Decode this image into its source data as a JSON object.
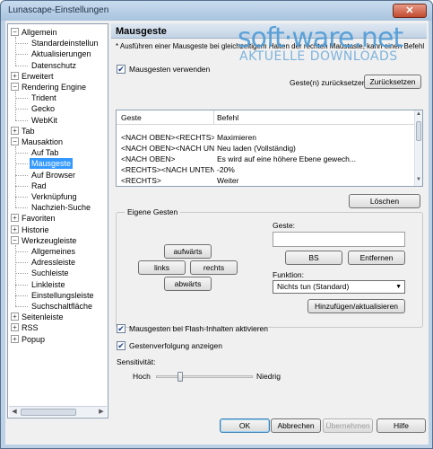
{
  "window": {
    "title": "Lunascape-Einstellungen",
    "close_glyph": "✕"
  },
  "watermark": {
    "main": "soft·ware.net",
    "sub": "AKTUELLE DOWNLOADS"
  },
  "tree": {
    "items": [
      {
        "label": "Allgemein",
        "expander": "−",
        "level": 0
      },
      {
        "label": "Standardeinstellun",
        "level": 1
      },
      {
        "label": "Aktualisierungen",
        "level": 1
      },
      {
        "label": "Datenschutz",
        "level": 1
      },
      {
        "label": "Erweitert",
        "expander": "+",
        "level": 0
      },
      {
        "label": "Rendering Engine",
        "expander": "−",
        "level": 0
      },
      {
        "label": "Trident",
        "level": 1
      },
      {
        "label": "Gecko",
        "level": 1
      },
      {
        "label": "WebKit",
        "level": 1
      },
      {
        "label": "Tab",
        "expander": "+",
        "level": 0
      },
      {
        "label": "Mausaktion",
        "expander": "−",
        "level": 0
      },
      {
        "label": "Auf Tab",
        "level": 1
      },
      {
        "label": "Mausgeste",
        "level": 1,
        "selected": true
      },
      {
        "label": "Auf Browser",
        "level": 1
      },
      {
        "label": "Rad",
        "level": 1
      },
      {
        "label": "Verknüpfung",
        "level": 1
      },
      {
        "label": "Nachzieh-Suche",
        "level": 1
      },
      {
        "label": "Favoriten",
        "expander": "+",
        "level": 0
      },
      {
        "label": "Historie",
        "expander": "+",
        "level": 0
      },
      {
        "label": "Werkzeugleiste",
        "expander": "−",
        "level": 0
      },
      {
        "label": "Allgemeines",
        "level": 1
      },
      {
        "label": "Adressleiste",
        "level": 1
      },
      {
        "label": "Suchleiste",
        "level": 1
      },
      {
        "label": "Linkleiste",
        "level": 1
      },
      {
        "label": "Einstellungsleiste",
        "level": 1
      },
      {
        "label": "Suchschaltfläche",
        "level": 1
      },
      {
        "label": "Seitenleiste",
        "expander": "+",
        "level": 0
      },
      {
        "label": "RSS",
        "expander": "+",
        "level": 0
      },
      {
        "label": "Popup",
        "expander": "+",
        "level": 0
      }
    ]
  },
  "panel": {
    "title": "Mausgeste",
    "hint": "* Ausführen einer Mausgeste bei gleichzeitigem Halten der rechten Maustaste, kann einen Befehl",
    "enable_label": "Mausgesten verwenden",
    "enable_checked": "✔",
    "reset_label": "Geste(n) zurücksetzen",
    "reset_button": "Zurücksetzen",
    "table": {
      "col_gesture": "Geste",
      "col_command": "Befehl",
      "rows": [
        {
          "gesture": "<NACH OBEN><RECHTS>",
          "command": "Maximieren"
        },
        {
          "gesture": "<NACH OBEN><NACH UN...",
          "command": "Neu laden (Vollständig)"
        },
        {
          "gesture": "<NACH OBEN>",
          "command": "Es wird auf eine höhere Ebene gewech..."
        },
        {
          "gesture": "<RECHTS><NACH UNTEN>",
          "command": "-20%"
        },
        {
          "gesture": "<RECHTS>",
          "command": "Weiter"
        }
      ]
    },
    "delete_button": "Löschen",
    "own_gestures": {
      "title": "Eigene Gesten",
      "up": "aufwärts",
      "left": "links",
      "right": "rechts",
      "down": "abwärts",
      "gesture_label": "Geste:",
      "gesture_value": "",
      "bs_button": "BS",
      "remove_button": "Entfernen",
      "function_label": "Funktion:",
      "function_value": "Nichts tun (Standard)",
      "add_button": "Hinzufügen/aktualisieren"
    },
    "flash_label": "Mausgesten bei Flash-Inhalten aktivieren",
    "flash_checked": "✔",
    "trace_label": "Gestenverfolgung anzeigen",
    "trace_checked": "✔",
    "sensitivity_label": "Sensitivität:",
    "sens_high": "Hoch",
    "sens_low": "Niedrig",
    "sensitivity_level": 0.25
  },
  "footer": {
    "ok": "OK",
    "cancel": "Abbrechen",
    "apply": "Übernehmen",
    "help": "Hilfe"
  }
}
